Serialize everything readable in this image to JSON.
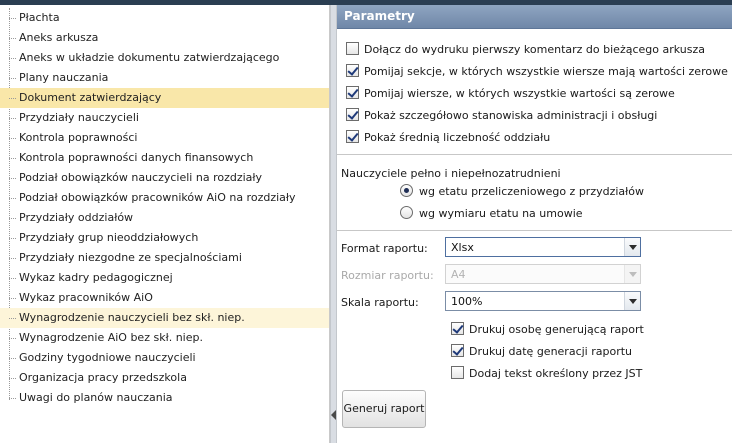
{
  "tree": {
    "items": [
      {
        "label": "Płachta"
      },
      {
        "label": "Aneks arkusza"
      },
      {
        "label": "Aneks w układzie dokumentu zatwierdzającego"
      },
      {
        "label": "Plany nauczania"
      },
      {
        "label": "Dokument zatwierdzający"
      },
      {
        "label": "Przydziały nauczycieli"
      },
      {
        "label": "Kontrola poprawności"
      },
      {
        "label": "Kontrola poprawności danych finansowych"
      },
      {
        "label": "Podział obowiązków nauczycieli na rozdziały"
      },
      {
        "label": "Podział obowiązków pracowników AiO na rozdziały"
      },
      {
        "label": "Przydziały oddziałów"
      },
      {
        "label": "Przydziały grup nieoddziałowych"
      },
      {
        "label": "Przydziały niezgodne ze specjalnościami"
      },
      {
        "label": "Wykaz kadry pedagogicznej"
      },
      {
        "label": "Wykaz pracowników AiO"
      },
      {
        "label": "Wynagrodzenie nauczycieli bez skł. niep."
      },
      {
        "label": "Wynagrodzenie AiO bez skł. niep."
      },
      {
        "label": "Godziny tygodniowe nauczycieli"
      },
      {
        "label": "Organizacja pracy przedszkola"
      },
      {
        "label": "Uwagi do planów nauczania"
      }
    ],
    "selected_label": "Dokument zatwierdzający",
    "hovered_label": "Wynagrodzenie nauczycieli bez skł. niep."
  },
  "panel": {
    "title": "Parametry",
    "options": [
      {
        "label": "Dołącz do wydruku pierwszy komentarz do bieżącego arkusza",
        "checked": false
      },
      {
        "label": "Pomijaj sekcje, w których wszystkie wiersze mają wartości zerowe",
        "checked": true
      },
      {
        "label": "Pomijaj wiersze, w których wszystkie wartości są zerowe",
        "checked": true
      },
      {
        "label": "Pokaż szczegółowo stanowiska administracji i obsługi",
        "checked": true
      },
      {
        "label": "Pokaż średnią liczebność oddziału",
        "checked": true
      }
    ],
    "teachers_label": "Nauczyciele pełno i niepełnozatrudnieni",
    "radios": [
      {
        "label": "wg etatu przeliczeniowego z przydziałów",
        "checked": true
      },
      {
        "label": "wg wymiaru etatu na umowie",
        "checked": false
      }
    ],
    "format": {
      "label": "Format raportu:",
      "value": "Xlsx"
    },
    "size": {
      "label": "Rozmiar raportu:",
      "value": "A4"
    },
    "scale": {
      "label": "Skala raportu:",
      "value": "100%"
    },
    "print_options": [
      {
        "label": "Drukuj osobę generującą raport",
        "checked": true
      },
      {
        "label": "Drukuj datę generacji raportu",
        "checked": true
      },
      {
        "label": "Dodaj tekst określony przez JST",
        "checked": false
      }
    ],
    "generate_label": "Generuj raport"
  },
  "colors": {
    "header": "#7f96b6",
    "selected_row": "#f9e7a9",
    "hover_row": "#fdf5d9"
  }
}
